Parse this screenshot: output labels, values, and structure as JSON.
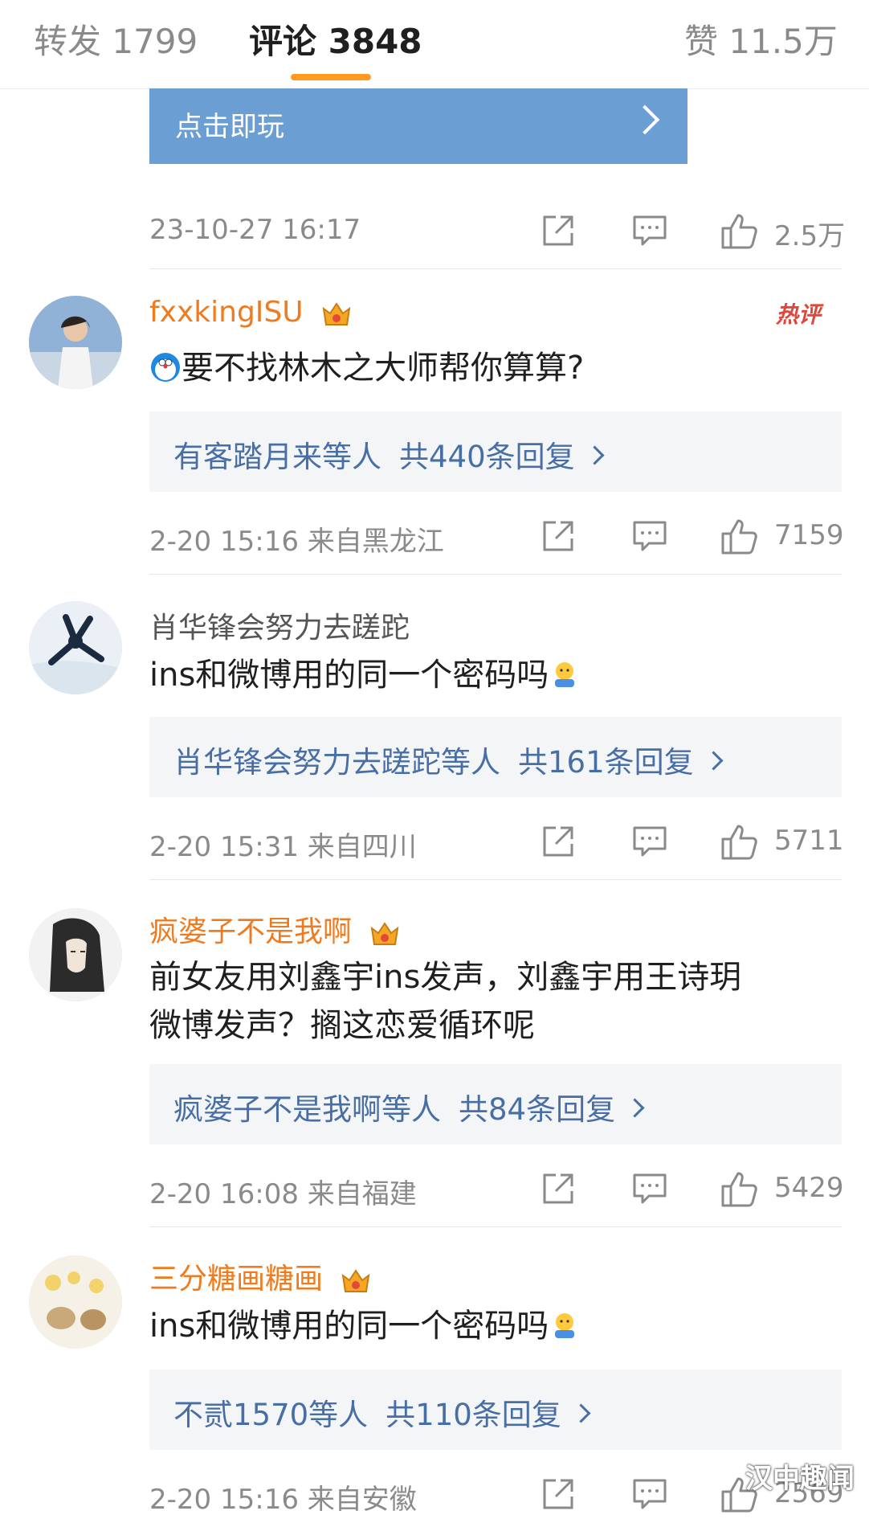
{
  "tabs": {
    "repost": "转发 1799",
    "comments": "评论 3848",
    "likes": "赞 11.5万"
  },
  "banner": {
    "label": "点击即玩"
  },
  "post_meta": {
    "time": "23-10-27 16:17",
    "like_count": "2.5万"
  },
  "hot_tag": "热评",
  "comments": [
    {
      "username": "fxxkingISU",
      "content": "要不找林木之大师帮你算算?",
      "reply_users": "有客踏月来等人",
      "reply_count": "共440条回复",
      "time": "2-20 15:16  来自黑龙江",
      "likes": "7159"
    },
    {
      "username": "肖华锋会努力去蹉跎",
      "content": "ins和微博用的同一个密码吗",
      "reply_users": "肖华锋会努力去蹉跎等人",
      "reply_count": "共161条回复",
      "time": "2-20 15:31  来自四川",
      "likes": "5711"
    },
    {
      "username": "疯婆子不是我啊",
      "content_line1": "前女友用刘鑫宇ins发声，刘鑫宇用王诗玥",
      "content_line2": "微博发声？搁这恋爱循环呢",
      "reply_users": "疯婆子不是我啊等人",
      "reply_count": "共84条回复",
      "time": "2-20 16:08  来自福建",
      "likes": "5429"
    },
    {
      "username": "三分糖画糖画",
      "content": "ins和微博用的同一个密码吗",
      "reply_users": "不贰1570等人",
      "reply_count": "共110条回复",
      "time": "2-20 15:16  来自安徽",
      "likes": "2569"
    }
  ],
  "watermark": "汉中趣闻",
  "colors": {
    "accent": "#ff9a1f",
    "username_orange": "#f07b1f",
    "reply_link": "#486fa5",
    "banner": "#6b9fd4"
  }
}
